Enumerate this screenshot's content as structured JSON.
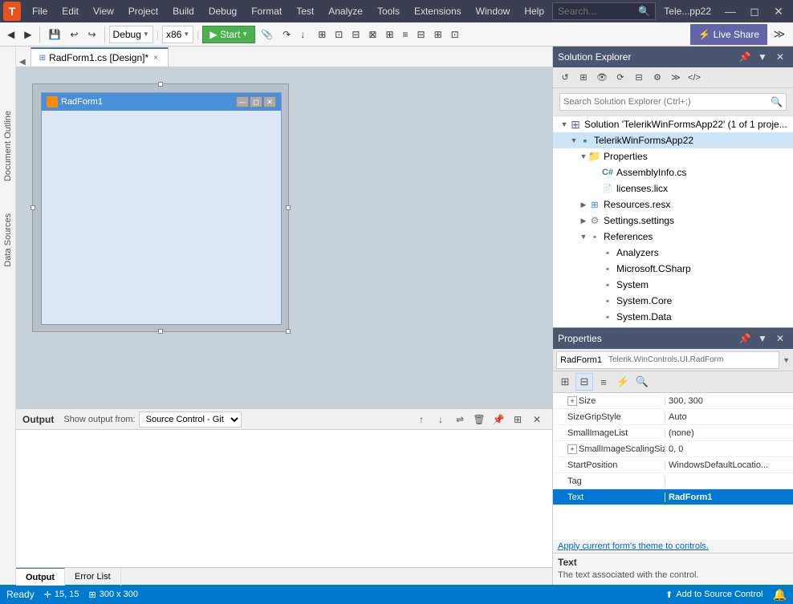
{
  "app": {
    "title": "Tele...pp22"
  },
  "menu": {
    "logo": "T",
    "items": [
      "File",
      "Edit",
      "View",
      "Project",
      "Build",
      "Debug",
      "Format",
      "Test",
      "Analyze",
      "Tools",
      "Extensions",
      "Window",
      "Help"
    ],
    "search_placeholder": "Search...",
    "search_shortcut": "⌕"
  },
  "toolbar": {
    "debug_config": "Debug",
    "platform": "x86",
    "start_label": "▶ Start",
    "live_share": "⚡ Live Share"
  },
  "tabs": {
    "active": "RadForm1.cs [Design]*",
    "close": "×",
    "items": [
      "RadForm1.cs [Design]*"
    ]
  },
  "design": {
    "form_title": "RadForm1",
    "form_icon": "🔶"
  },
  "output": {
    "title": "Output",
    "show_label": "Show output from:",
    "source": "Source Control - Git",
    "tabs": [
      "Output",
      "Error List"
    ]
  },
  "solution_explorer": {
    "title": "Solution Explorer",
    "search_placeholder": "Search Solution Explorer (Ctrl+;)",
    "solution_label": "Solution 'TelerikWinFormsApp22' (1 of 1 proje...",
    "project_label": "TelerikWinFormsApp22",
    "tree": [
      {
        "label": "Properties",
        "level": 2,
        "icon": "folder",
        "expanded": true
      },
      {
        "label": "AssemblyInfo.cs",
        "level": 3,
        "icon": "cs"
      },
      {
        "label": "licenses.licx",
        "level": 3,
        "icon": "file"
      },
      {
        "label": "Resources.resx",
        "level": 2,
        "icon": "resx",
        "hasArrow": true
      },
      {
        "label": "Settings.settings",
        "level": 2,
        "icon": "settings",
        "hasArrow": true
      },
      {
        "label": "References",
        "level": 2,
        "icon": "ref",
        "expanded": true
      },
      {
        "label": "Analyzers",
        "level": 3,
        "icon": "ref"
      },
      {
        "label": "Microsoft.CSharp",
        "level": 3,
        "icon": "ref"
      },
      {
        "label": "System",
        "level": 3,
        "icon": "ref"
      },
      {
        "label": "System.Core",
        "level": 3,
        "icon": "ref"
      },
      {
        "label": "System.Data",
        "level": 3,
        "icon": "ref"
      }
    ]
  },
  "properties": {
    "title": "Properties",
    "object": "RadForm1",
    "object_type": "Telerik.WinControls.UI.RadForm",
    "rows": [
      {
        "name": "Size",
        "value": "300, 300",
        "expanded": false
      },
      {
        "name": "SizeGripStyle",
        "value": "Auto"
      },
      {
        "name": "SmallImageList",
        "value": "(none)"
      },
      {
        "name": "SmallImageScalingSize",
        "value": "0, 0",
        "expanded": false
      },
      {
        "name": "StartPosition",
        "value": "WindowsDefaultLocatio..."
      },
      {
        "name": "Tag",
        "value": ""
      },
      {
        "name": "Text",
        "value": "RadForm1",
        "bold": true
      }
    ],
    "apply_link": "Apply current form's theme to controls.",
    "desc_title": "Text",
    "desc_text": "The text associated with the control."
  },
  "status": {
    "ready": "Ready",
    "position": "15, 15",
    "size": "300 x 300",
    "source_control": "Add to Source Control"
  },
  "sidebar": {
    "items": [
      "Document Outline",
      "Data Sources"
    ]
  }
}
